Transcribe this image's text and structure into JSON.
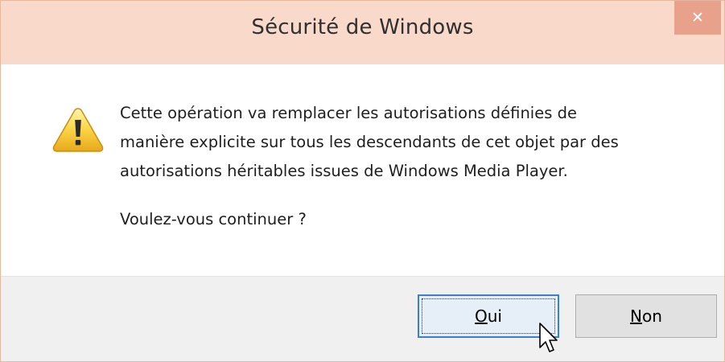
{
  "dialog": {
    "title": "Sécurité de Windows",
    "close_glyph": "✕",
    "icon": "warning-icon",
    "message_lines": [
      "Cette opération va remplacer les autorisations définies de",
      "manière explicite sur tous les descendants de cet objet par des",
      "autorisations héritables issues de Windows Media Player."
    ],
    "question": "Voulez-vous continuer ?",
    "buttons": {
      "yes": {
        "access_key": "O",
        "rest": "ui"
      },
      "no": {
        "access_key": "N",
        "rest": "on"
      }
    }
  },
  "colors": {
    "titlebar": "#f9d9c9",
    "close_button": "#e8a28b",
    "footer": "#f0f0f0",
    "default_button_border": "#3c7fd2"
  },
  "cursor": "arrow-pointer-icon"
}
